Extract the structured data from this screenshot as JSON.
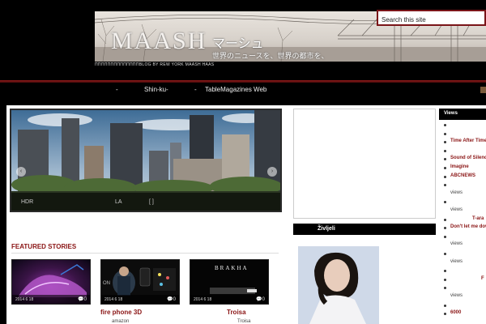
{
  "header": {
    "brand_title": "MAASH",
    "brand_jp": "マーシュ",
    "brand_tagline": "世界のニュースを、世界の都市を、",
    "brand_sub": "ΠΠΠΠΠΠΠΠΠΠΠΠΠΠBLOG BY REW YORK MAASH HAAS",
    "search_placeholder": "Search this site"
  },
  "nav": {
    "items": [
      "-",
      "Shin-ku",
      "-",
      "-",
      "TableMagazines Web"
    ]
  },
  "slider": {
    "caption_left": "HDR",
    "caption_mid": "LA",
    "caption_right": "[ ]",
    "prev_label": "‹",
    "next_label": "›"
  },
  "featured": {
    "heading": "FEATURED STORIES",
    "stories": [
      {
        "title": "",
        "subtitle": "",
        "date": "2014  6  18",
        "comments": "0"
      },
      {
        "title": "fire phone  3D",
        "subtitle": "amazon",
        "date": "2014  6  18",
        "comments": "0",
        "image_text": "ON"
      },
      {
        "title": "Troisa",
        "subtitle": "Troisa",
        "date": "2014  6  18",
        "comments": "0",
        "image_text": "BRAKHA"
      }
    ]
  },
  "middle": {
    "section_heading": "Življeli"
  },
  "right": {
    "heading": "Views",
    "items": [
      {
        "type": "bullet"
      },
      {
        "type": "bullet"
      },
      {
        "type": "link",
        "text": "Time After Time"
      },
      {
        "type": "bullet"
      },
      {
        "type": "link",
        "text": "Sound of Silence"
      },
      {
        "type": "link",
        "text": "Imagine"
      },
      {
        "type": "link",
        "text": "ABCNEWS"
      },
      {
        "type": "bullet"
      },
      {
        "type": "views",
        "text": "views"
      },
      {
        "type": "bullet"
      },
      {
        "type": "views",
        "text": "views"
      },
      {
        "type": "link",
        "text": "T-ara"
      },
      {
        "type": "link",
        "text": "Don't let me down"
      },
      {
        "type": "bullet"
      },
      {
        "type": "views",
        "text": "views"
      },
      {
        "type": "bullet"
      },
      {
        "type": "views",
        "text": "views"
      },
      {
        "type": "bullet"
      },
      {
        "type": "link",
        "text": "F"
      },
      {
        "type": "bullet"
      },
      {
        "type": "views",
        "text": "views"
      },
      {
        "type": "bullet"
      },
      {
        "type": "link",
        "text": "6000"
      }
    ]
  }
}
